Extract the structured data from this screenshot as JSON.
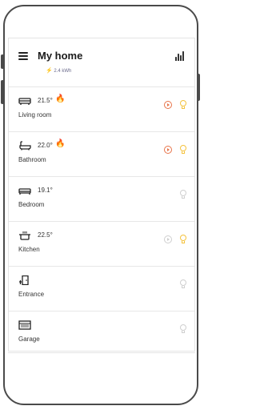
{
  "header": {
    "title": "My home",
    "energy": "2.4 kWh",
    "menu_icon": "menu-icon",
    "stats_icon": "bar-chart-icon"
  },
  "rooms": [
    {
      "name": "Living room",
      "temperature": "21.5°",
      "icon": "sofa-icon",
      "heating": true,
      "media_active": true,
      "light_on": true
    },
    {
      "name": "Bathroom",
      "temperature": "22.0°",
      "icon": "bathtub-icon",
      "heating": true,
      "media_active": true,
      "light_on": true
    },
    {
      "name": "Bedroom",
      "temperature": "19.1°",
      "icon": "bed-icon",
      "heating": false,
      "media_active": false,
      "light_on": false
    },
    {
      "name": "Kitchen",
      "temperature": "22.5°",
      "icon": "cooking-pot-icon",
      "heating": false,
      "media_active": false,
      "light_on": true
    },
    {
      "name": "Entrance",
      "temperature": "",
      "icon": "door-icon",
      "heating": false,
      "media_active": false,
      "light_on": false
    },
    {
      "name": "Garage",
      "temperature": "",
      "icon": "garage-icon",
      "heating": false,
      "media_active": false,
      "light_on": false
    }
  ],
  "colors": {
    "heating": "#e8743b",
    "media_active": "#e8744a",
    "light_on": "#f4c23c",
    "inactive": "#cfcfcf",
    "energy_bolt": "#e24c4c"
  }
}
